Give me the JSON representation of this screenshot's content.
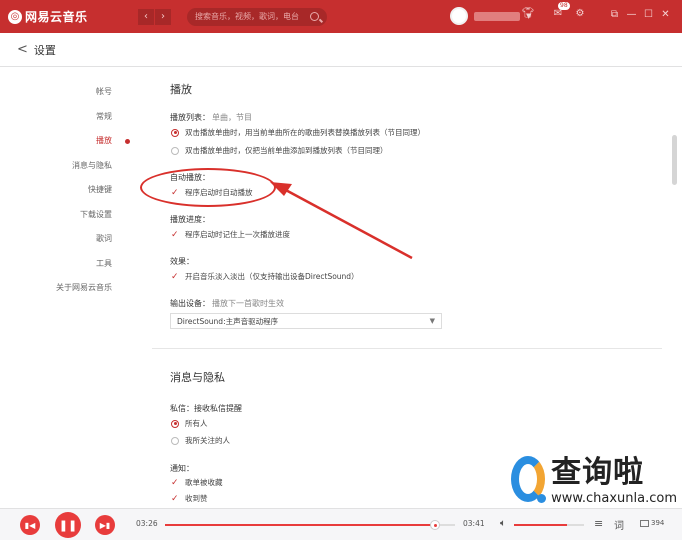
{
  "app": {
    "logo_text": "网易云音乐",
    "logo_glyph": "◎"
  },
  "titlebar": {
    "search_placeholder": "搜索音乐，视频，歌词，电台",
    "mail_badge": "98",
    "icons": [
      "skin-icon",
      "mail-icon",
      "settings-icon",
      "mini-mode-icon",
      "minimize-icon",
      "maximize-icon",
      "close-icon"
    ]
  },
  "header": {
    "back": "<",
    "title": "设置"
  },
  "nav": {
    "items": [
      {
        "label": "帐号"
      },
      {
        "label": "常规"
      },
      {
        "label": "播放"
      },
      {
        "label": "消息与隐私"
      },
      {
        "label": "快捷键"
      },
      {
        "label": "下载设置"
      },
      {
        "label": "歌词"
      },
      {
        "label": "工具"
      },
      {
        "label": "关于网易云音乐"
      }
    ],
    "active_index": 2
  },
  "play": {
    "title": "播放",
    "playlist_label": "播放列表：",
    "playlist_hint": "单曲，节目",
    "playlist_opt1": "双击播放单曲时，用当前单曲所在的歌曲列表替换播放列表（节目同理）",
    "playlist_opt2": "双击播放单曲时，仅把当前单曲添加到播放列表（节目同理）",
    "autoplay_label": "自动播放：",
    "autoplay_opt": "程序启动时自动播放",
    "progress_label": "播放进度：",
    "progress_opt": "程序启动时记住上一次播放进度",
    "effect_label": "效果：",
    "effect_opt": "开启音乐淡入淡出（仅支持输出设备DirectSound）",
    "output_label": "输出设备：",
    "output_hint": "播放下一首歌时生效",
    "output_value": "DirectSound:主声音驱动程序"
  },
  "privacy": {
    "title": "消息与隐私",
    "dm_label": "私信：",
    "dm_hint": "接收私信提醒",
    "dm_opt1": "所有人",
    "dm_opt2": "我所关注的人",
    "notify_label": "通知：",
    "notify_opt1": "歌单被收藏",
    "notify_opt2": "收到赞"
  },
  "player": {
    "time_current": "03:26",
    "time_total": "03:41",
    "progress": 0.93,
    "volume": 0.75,
    "playlist_count": "394",
    "accent": "#e83c3c"
  },
  "watermark": {
    "cn": "查询啦",
    "en": "www.chaxunla.com"
  },
  "colors": {
    "brand": "#c62f2f",
    "annotation": "#d9302b"
  }
}
